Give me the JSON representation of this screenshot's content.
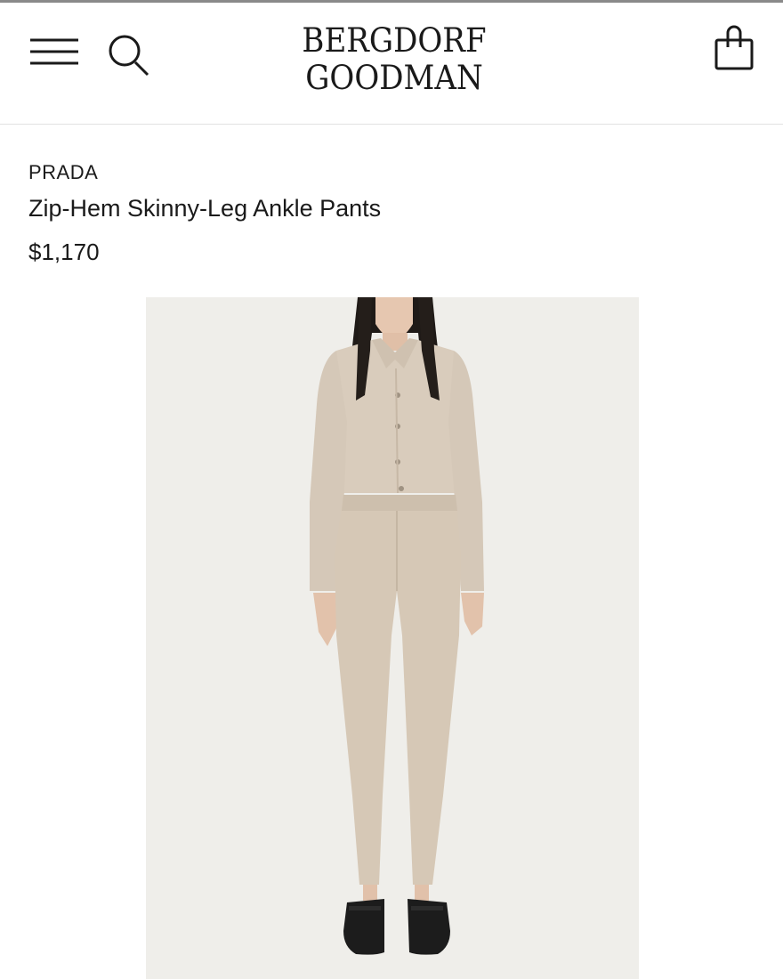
{
  "header": {
    "logo_line1": "BERGDORF",
    "logo_line2": "GOODMAN",
    "menu_icon": "hamburger-menu-icon",
    "search_icon": "search-icon",
    "bag_icon": "shopping-bag-icon"
  },
  "product": {
    "brand": "PRADA",
    "title": "Zip-Hem Skinny-Leg Ankle Pants",
    "price": "$1,170"
  },
  "colors": {
    "text": "#1a1a1a",
    "image_background": "#efeeea",
    "garment": "#d6c8b6"
  }
}
